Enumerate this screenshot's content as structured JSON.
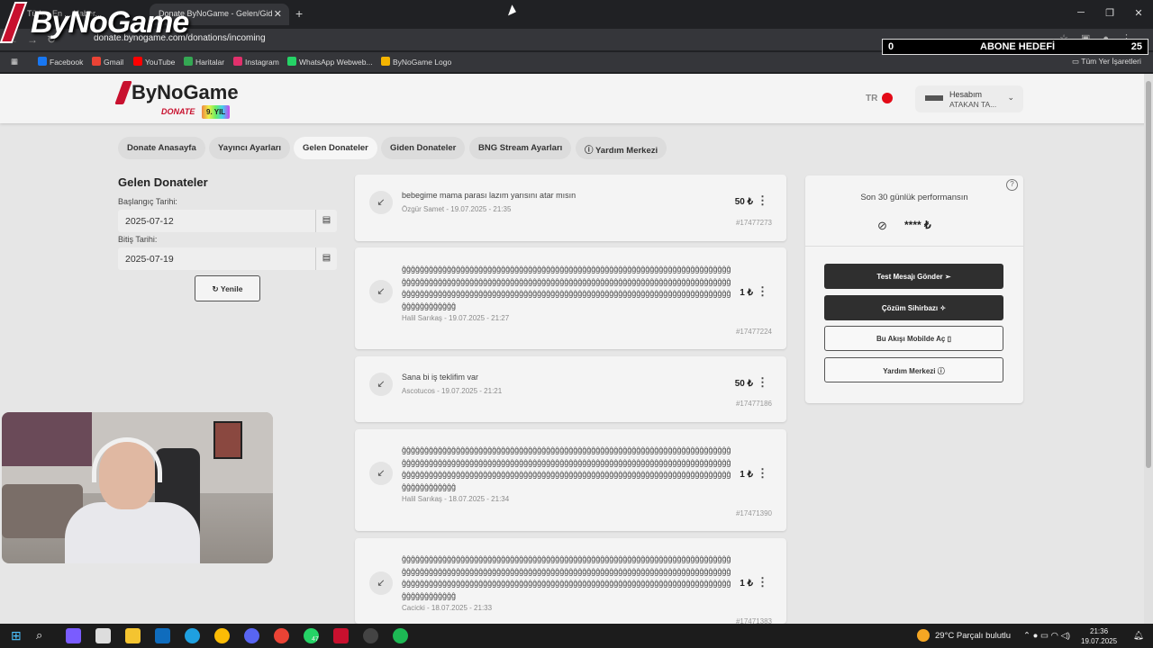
{
  "browser": {
    "tabs": [
      {
        "title": "Türk... En ... Haber..."
      },
      {
        "title": "Donate ByNoGame - Gelen/Gid"
      }
    ],
    "new_tab": "+",
    "url": "donate.bynogame.com/donations/incoming",
    "bookmarks": [
      {
        "label": "Facebook",
        "color": "#1877f2"
      },
      {
        "label": "Gmail",
        "color": "#ea4335"
      },
      {
        "label": "YouTube",
        "color": "#ff0000"
      },
      {
        "label": "Haritalar",
        "color": "#34a853"
      },
      {
        "label": "Instagram",
        "color": "#e1306c"
      },
      {
        "label": "WhatsApp Webweb...",
        "color": "#25d366"
      },
      {
        "label": "ByNoGame Logo",
        "color": "#f4b400"
      }
    ],
    "all_bookmarks": "Tüm Yer İşaretleri"
  },
  "overlay": {
    "logo_text": "ByNoGame",
    "goal_left": "0",
    "goal_label": "ABONE HEDEFİ",
    "goal_right": "25"
  },
  "site": {
    "brand_name": "ByNoGame",
    "brand_sub": "DONATE",
    "brand_badge": "9. YIL",
    "lang": "TR",
    "account_title": "Hesabım",
    "account_name": "ATAKAN TA..."
  },
  "nav": [
    {
      "label": "Donate Anasayfa"
    },
    {
      "label": "Yayıncı Ayarları"
    },
    {
      "label": "Gelen Donateler",
      "active": true
    },
    {
      "label": "Giden Donateler"
    },
    {
      "label": "BNG Stream Ayarları"
    },
    {
      "label": "Yardım Merkezi"
    }
  ],
  "filters": {
    "title": "Gelen Donateler",
    "start_label": "Başlangıç Tarihi:",
    "start_value": "2025-07-12",
    "end_label": "Bitiş Tarihi:",
    "end_value": "2025-07-19",
    "refresh_label": "Yenile"
  },
  "donations": [
    {
      "message": "bebegime mama parası lazım yarısını atar mısın",
      "sender": "Özgür Samet",
      "date": "19.07.2025 - 21:35",
      "amount": "50 ₺",
      "id": "#17477273"
    },
    {
      "message": "ĝĝĝĝĝĝĝĝĝĝĝĝĝĝĝĝĝĝĝĝĝĝĝĝĝĝĝĝĝĝĝĝĝĝĝĝĝĝĝĝĝĝĝĝĝĝĝĝĝĝĝĝĝĝĝĝĝĝĝĝĝĝĝĝĝĝĝĝĝĝĝĝĝĝĝĝĝĝĝĝĝĝĝĝĝĝĝĝĝĝĝĝĝĝĝĝĝĝĝĝĝĝĝĝĝĝĝĝĝĝĝĝĝĝĝĝĝĝĝĝĝĝĝĝĝĝĝĝĝĝĝĝĝĝĝĝĝĝĝĝĝĝĝĝĝĝĝĝĝĝĝĝĝĝĝĝĝĝĝĝĝĝĝĝĝĝĝĝĝĝĝĝĝĝĝĝĝĝĝĝĝĝĝĝĝĝĝĝĝĝĝĝĝĝĝĝĝĝĝĝĝĝĝĝĝĝĝĝĝĝĝĝĝĝĝĝĝĝĝĝĝĝĝĝĝĝĝĝĝĝĝ",
      "sender": "Halil Sarıkaş",
      "date": "19.07.2025 - 21:27",
      "amount": "1 ₺",
      "id": "#17477224"
    },
    {
      "message": "Sana bi iş teklifim var",
      "sender": "Ascotucos",
      "date": "19.07.2025 - 21:21",
      "amount": "50 ₺",
      "id": "#17477186"
    },
    {
      "message": "ĝĝĝĝĝĝĝĝĝĝĝĝĝĝĝĝĝĝĝĝĝĝĝĝĝĝĝĝĝĝĝĝĝĝĝĝĝĝĝĝĝĝĝĝĝĝĝĝĝĝĝĝĝĝĝĝĝĝĝĝĝĝĝĝĝĝĝĝĝĝĝĝĝĝĝĝĝĝĝĝĝĝĝĝĝĝĝĝĝĝĝĝĝĝĝĝĝĝĝĝĝĝĝĝĝĝĝĝĝĝĝĝĝĝĝĝĝĝĝĝĝĝĝĝĝĝĝĝĝĝĝĝĝĝĝĝĝĝĝĝĝĝĝĝĝĝĝĝĝĝĝĝĝĝĝĝĝĝĝĝĝĝĝĝĝĝĝĝĝĝĝĝĝĝĝĝĝĝĝĝĝĝĝĝĝĝĝĝĝĝĝĝĝĝĝĝĝĝĝĝĝĝĝĝĝĝĝĝĝĝĝĝĝĝĝĝĝĝĝĝĝĝĝĝĝĝĝĝĝĝĝ",
      "sender": "Halil Sarıkaş",
      "date": "18.07.2025 - 21:34",
      "amount": "1 ₺",
      "id": "#17471390"
    },
    {
      "message": "ĝĝĝĝĝĝĝĝĝĝĝĝĝĝĝĝĝĝĝĝĝĝĝĝĝĝĝĝĝĝĝĝĝĝĝĝĝĝĝĝĝĝĝĝĝĝĝĝĝĝĝĝĝĝĝĝĝĝĝĝĝĝĝĝĝĝĝĝĝĝĝĝĝĝĝĝĝĝĝĝĝĝĝĝĝĝĝĝĝĝĝĝĝĝĝĝĝĝĝĝĝĝĝĝĝĝĝĝĝĝĝĝĝĝĝĝĝĝĝĝĝĝĝĝĝĝĝĝĝĝĝĝĝĝĝĝĝĝĝĝĝĝĝĝĝĝĝĝĝĝĝĝĝĝĝĝĝĝĝĝĝĝĝĝĝĝĝĝĝĝĝĝĝĝĝĝĝĝĝĝĝĝĝĝĝĝĝĝĝĝĝĝĝĝĝĝĝĝĝĝĝĝĝĝĝĝĝĝĝĝĝĝĝĝĝĝĝĝĝĝĝĝĝĝĝĝĝĝĝĝĝ",
      "sender": "Cacicki",
      "date": "18.07.2025 - 21:33",
      "amount": "1 ₺",
      "id": "#17471383"
    }
  ],
  "performance": {
    "title": "Son 30 günlük performansın",
    "masked_value": "**** ₺",
    "buttons": [
      {
        "label": "Test Mesajı Gönder",
        "icon": "send-icon"
      },
      {
        "label": "Çözüm Sihirbazı",
        "icon": "sparkle-icon"
      },
      {
        "label": "Bu Akışı Mobilde Aç",
        "icon": "phone-icon"
      },
      {
        "label": "Yardım Merkezi",
        "icon": "help-icon"
      }
    ]
  },
  "taskbar": {
    "weather": "29°C  Parçalı bulutlu",
    "time": "21:36",
    "date": "19.07.2025",
    "badge": "47"
  }
}
